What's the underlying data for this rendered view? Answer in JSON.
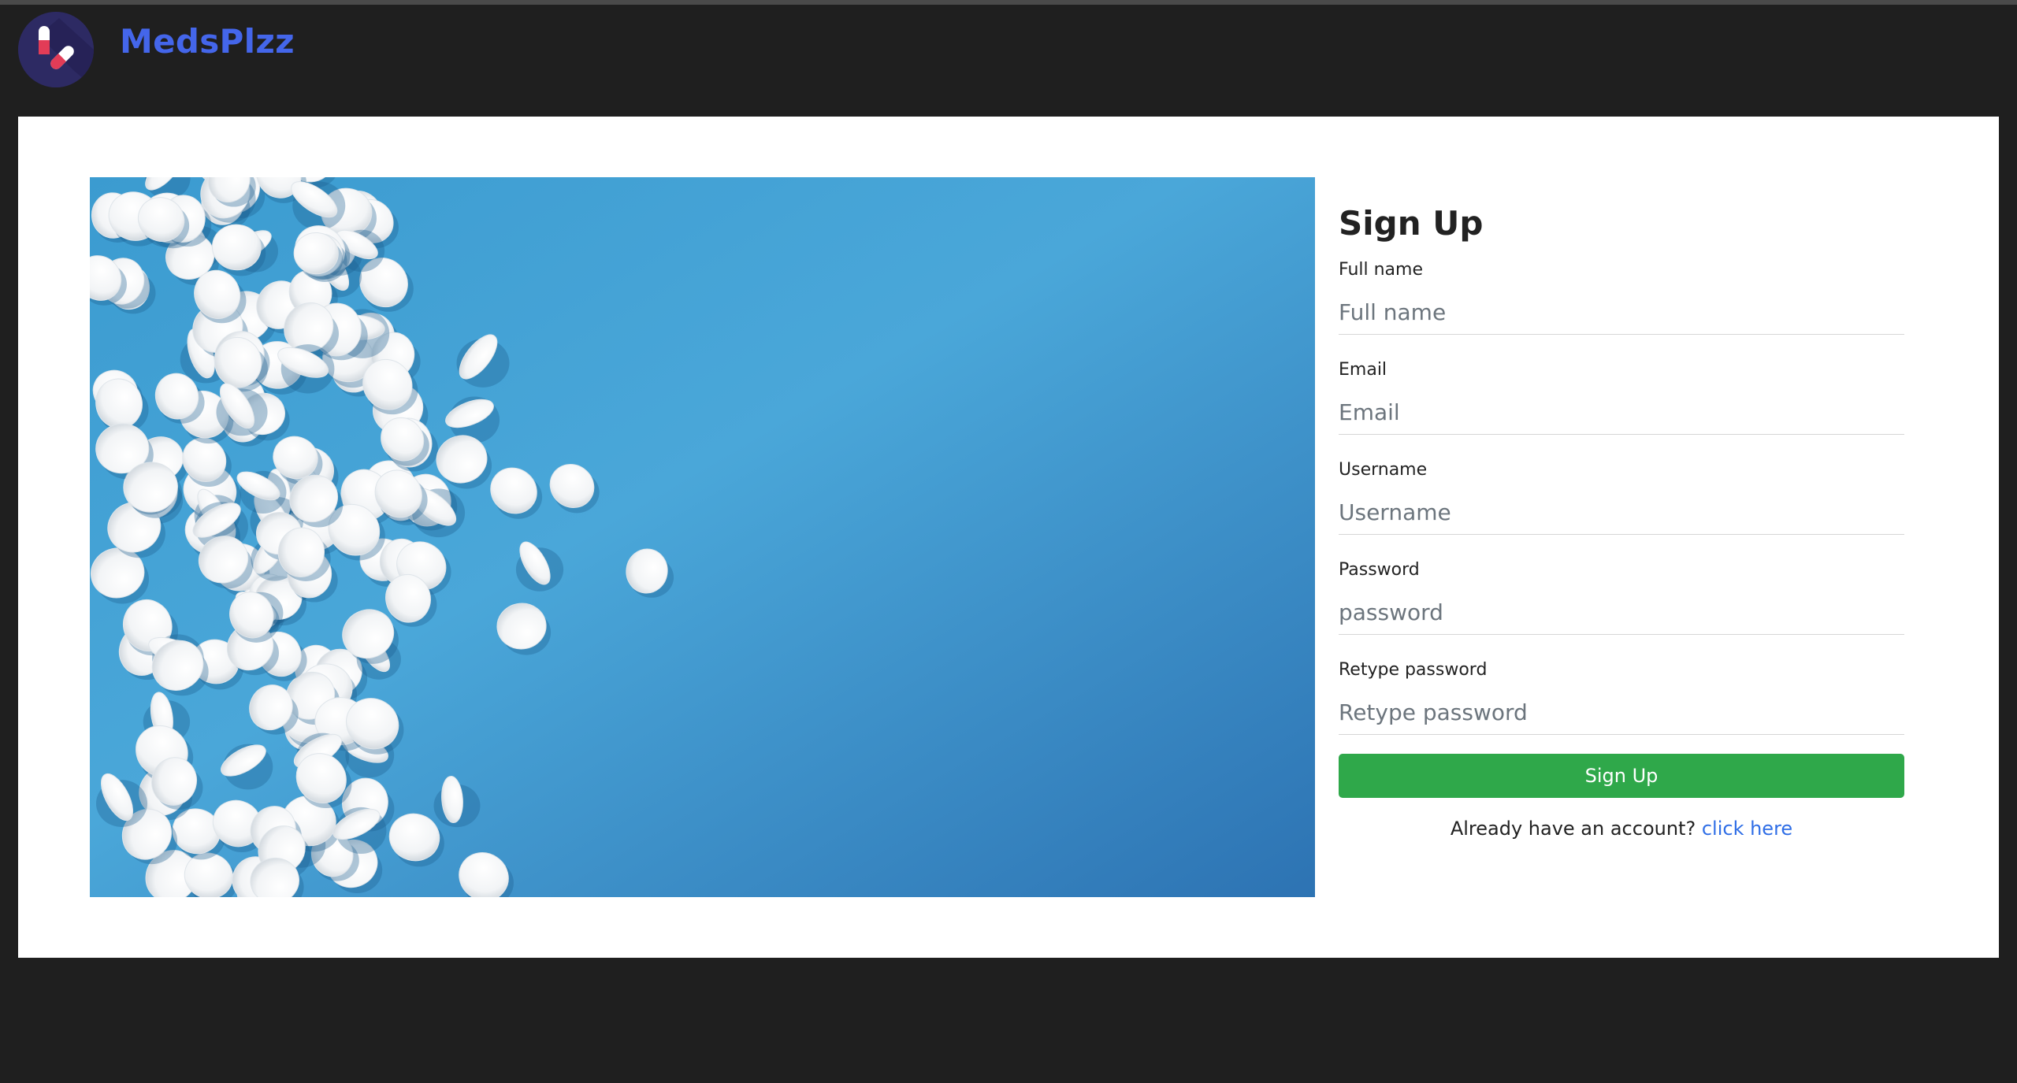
{
  "app": {
    "brand": "MedsPlzz",
    "colors": {
      "brand": "#4466ea",
      "navbar_bg": "#1f1f1f",
      "card_bg": "#ffffff",
      "hero_bg": "#3f9ed3",
      "primary_button": "#2fa84a",
      "link": "#2f6ee6"
    },
    "icons": {
      "logo": "pill-capsule-logo-icon"
    }
  },
  "signup": {
    "title": "Sign Up",
    "fields": [
      {
        "label": "Full name",
        "placeholder": "Full name",
        "value": ""
      },
      {
        "label": "Email",
        "placeholder": "Email",
        "value": ""
      },
      {
        "label": "Username",
        "placeholder": "Username",
        "value": ""
      },
      {
        "label": "Password",
        "placeholder": "password",
        "value": ""
      },
      {
        "label": "Retype password",
        "placeholder": "Retype password",
        "value": ""
      }
    ],
    "submit_label": "Sign Up",
    "footer_text": "Already have an account?",
    "footer_link": "click here"
  }
}
